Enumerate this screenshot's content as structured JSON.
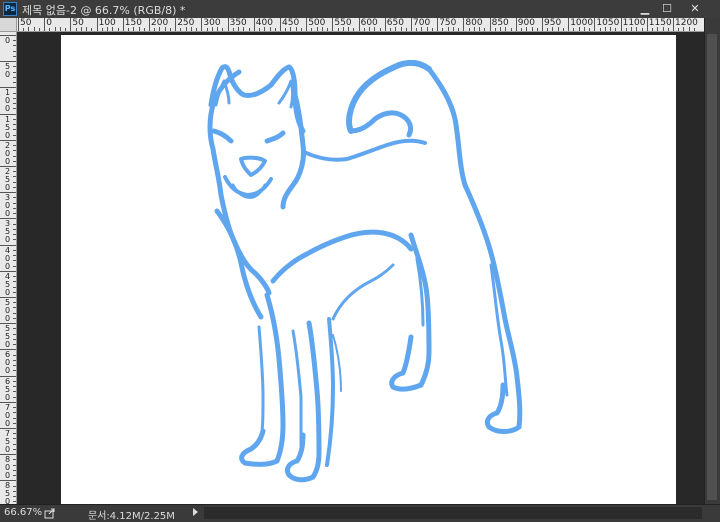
{
  "titlebar": {
    "app_icon": "Ps",
    "document_title": "제목 없음-2 @ 66.7% (RGB/8) *",
    "minimize_label": "▁",
    "maximize_label": "☐",
    "close_label": "✕"
  },
  "ruler_top": {
    "labels": [
      "50",
      "0",
      "50",
      "100",
      "150",
      "200",
      "250",
      "300",
      "350",
      "400",
      "450",
      "500",
      "550",
      "600",
      "650",
      "700",
      "750",
      "800",
      "850",
      "900",
      "950",
      "1000",
      "1050",
      "1100",
      "1150",
      "1200"
    ]
  },
  "ruler_left": {
    "labels": [
      "0",
      "50",
      "100",
      "150",
      "200",
      "250",
      "300",
      "350",
      "400",
      "450",
      "500",
      "550",
      "600",
      "650",
      "700",
      "750",
      "800",
      "850"
    ]
  },
  "statusbar": {
    "zoom": "66.67%",
    "doc_info": "문서:4.12M/2.25M"
  },
  "colors": {
    "stroke": "#5fa6ef",
    "canvas": "#ffffff",
    "workspace": "#282828"
  },
  "icons": {
    "share": "share-icon",
    "expand": "arrow-right-icon"
  }
}
